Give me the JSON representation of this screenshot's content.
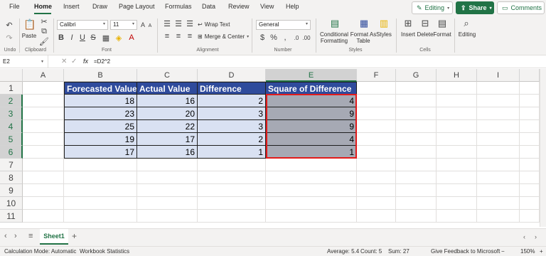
{
  "menu": {
    "items": [
      "File",
      "Home",
      "Insert",
      "Draw",
      "Page Layout",
      "Formulas",
      "Data",
      "Review",
      "View",
      "Help"
    ],
    "editing_label": "Editing",
    "share_label": "Share",
    "comments_label": "Comments"
  },
  "ribbon": {
    "undo_label": "Undo",
    "clipboard_label": "Clipboard",
    "paste_label": "Paste",
    "font_name": "Calibri",
    "font_size": "11",
    "font_label": "Font",
    "wrap_text_label": "Wrap Text",
    "merge_center_label": "Merge & Center",
    "alignment_label": "Alignment",
    "number_format": "General",
    "number_label": "Number",
    "conditional_formatting_label": "Conditional Formatting",
    "format_as_table_label": "Format As Table",
    "styles_button_label": "Styles",
    "styles_label": "Styles",
    "insert_label": "Insert",
    "delete_label": "Delete",
    "format_label": "Format",
    "cells_label": "Cells",
    "editing_label": "Editing"
  },
  "formula_bar": {
    "name_box": "E2",
    "fx_label": "fx",
    "formula": "=D2^2"
  },
  "grid": {
    "columns": [
      "A",
      "B",
      "C",
      "D",
      "E",
      "F",
      "G",
      "H",
      "I"
    ],
    "rows": [
      "1",
      "2",
      "3",
      "4",
      "5",
      "6",
      "7",
      "8",
      "9",
      "10",
      "11"
    ],
    "headers": [
      "Forecasted Value",
      "Actual Value",
      "Difference",
      "Square of Difference"
    ],
    "data": [
      [
        "18",
        "16",
        "2",
        "4"
      ],
      [
        "23",
        "20",
        "3",
        "9"
      ],
      [
        "25",
        "22",
        "3",
        "9"
      ],
      [
        "19",
        "17",
        "2",
        "4"
      ],
      [
        "17",
        "16",
        "1",
        "1"
      ]
    ]
  },
  "sheet_tabs": {
    "active": "Sheet1",
    "add_label": "+"
  },
  "status": {
    "calc_mode": "Calculation Mode: Automatic",
    "workbook_stats": "Workbook Statistics",
    "average": "Average: 5.4",
    "count": "Count: 5",
    "sum": "Sum: 27",
    "feedback": "Give Feedback to Microsoft",
    "zoom": "150%",
    "zoom_minus": "−",
    "zoom_plus": "+"
  },
  "colors": {
    "accent": "#217346",
    "table_header": "#2f4b9c",
    "table_fill": "#d9e1f2",
    "selection_fill": "#a6a9b4",
    "selection_border": "#e21b1b"
  },
  "icons": {
    "undo": "undo-icon",
    "redo": "redo-icon",
    "paste": "paste-icon",
    "cut": "scissors-icon",
    "copy": "copy-icon",
    "format_painter": "brush-icon",
    "search": "magnifier-icon",
    "all_sheets": "hamburger-icon"
  }
}
